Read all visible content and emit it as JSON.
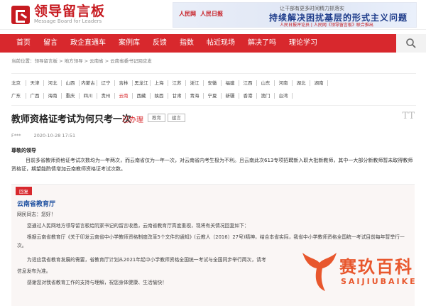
{
  "header": {
    "logo_title": "领导留言板",
    "logo_sub": "Message Board for Leaders",
    "banner": {
      "logo_left": "人民网",
      "logo_right": "人民日报",
      "line1": "让干部有更多时间精力抓落实",
      "line2": "持续解决困扰基层的形式主义问题",
      "line3": "人民日报评论员 | 人民网《领导留言板》联合推出"
    }
  },
  "nav": {
    "items": [
      "首页",
      "留言",
      "政企直通车",
      "案例库",
      "反馈",
      "指数",
      "帖近现场",
      "解决了吗",
      "理论学习"
    ]
  },
  "breadcrumb": "当前位置：领导留言板 > 地方领导 > 云南省 > 云南省委书记回应发",
  "regions": {
    "row1": [
      "北京",
      "天津",
      "河北",
      "山西",
      "内蒙古",
      "辽宁",
      "吉林",
      "黑龙江",
      "上海",
      "江苏",
      "浙江",
      "安徽",
      "福建",
      "江西",
      "山东",
      "河南",
      "湖北",
      "湖南"
    ],
    "row2": [
      "广东",
      "广西",
      "海南",
      "重庆",
      "四川",
      "贵州",
      "云南",
      "西藏",
      "陕西",
      "甘肃",
      "青海",
      "宁夏",
      "新疆",
      "香港",
      "澳门",
      "台湾"
    ]
  },
  "message": {
    "title": "教师资格证考试为何只考一次",
    "status": "已办理",
    "tag1": "教育",
    "tag2": "建言",
    "font_icon": "TT",
    "author": "F***",
    "date": "2020-10-28 17:51",
    "greeting": "尊敬的领导",
    "body": "目前多省教师资格证考试次数均为一年两次，而云南省仅为一年一次，对云南省内考生极为不利。且云南此次613专项招聘新入职大批新教师，其中一大部分新教师暂未取得教师资格证，期望能酌情增加云南教师资格证考试次数。"
  },
  "reply": {
    "badge": "回复",
    "org": "云南省教育厅",
    "p1": "网民同志：您好！",
    "p2": "您通过人民网地方领导留言板给阮家书记的留言收悉，云南省教育厅高度重视，现将有关情况回复如下：",
    "p3": "根据云南省教育厅《关于印发云南省中小学教师资格制度改革5个文件的通知》(云教人〔2016〕27号)精神，结合本省实际，我省中小学教师资格全国统一考试目前每年暂举行一次。",
    "p4": "为适应我省教育发展的需要，省教育厅计划从2021年起中小学教师资格全国统一考试与全国同步举行两次，请考",
    "p5": "信息发布为准。",
    "p6": "感谢您对我省教育工作的支持与理解，祝您身体健康、生活愉快！"
  },
  "watermark": {
    "text": "赛玖百科",
    "sub": "SAIJIUBAIKE"
  }
}
